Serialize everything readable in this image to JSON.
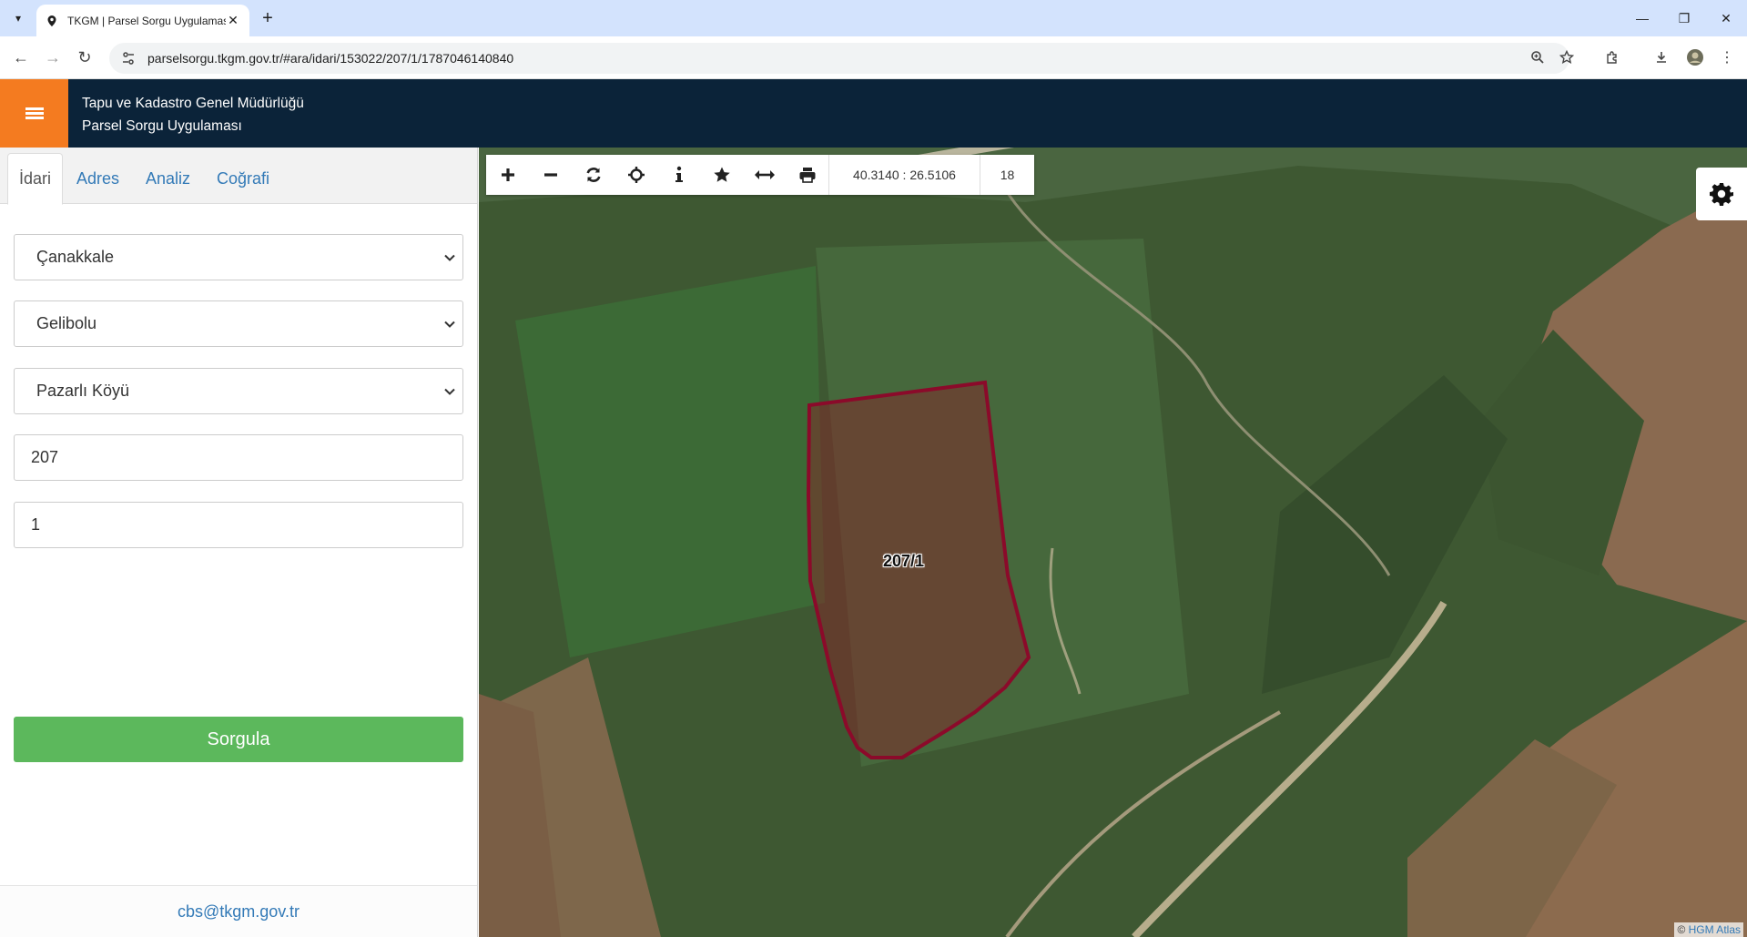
{
  "browser": {
    "tab_title": "TKGM | Parsel Sorgu Uygulaması",
    "url": "parselsorgu.tkgm.gov.tr/#ara/idari/153022/207/1/1787046140840"
  },
  "header": {
    "line1": "Tapu ve Kadastro Genel Müdürlüğü",
    "line2": "Parsel Sorgu Uygulaması"
  },
  "sidebar": {
    "tabs": [
      {
        "label": "İdari",
        "active": true
      },
      {
        "label": "Adres"
      },
      {
        "label": "Analiz"
      },
      {
        "label": "Coğrafi"
      }
    ],
    "province": "Çanakkale",
    "district": "Gelibolu",
    "neighborhood": "Pazarlı Köyü",
    "block": "207",
    "parcel": "1",
    "submit_label": "Sorgula",
    "footer_email": "cbs@tkgm.gov.tr"
  },
  "map": {
    "tools": [
      "plus-icon",
      "minus-icon",
      "refresh-icon",
      "locate-icon",
      "info-icon",
      "star-icon",
      "measure-icon",
      "print-icon"
    ],
    "coordinates": "40.3140 : 26.5106",
    "zoom": "18",
    "parcel_label": "207/1",
    "parcel_color": "#8b0a2a",
    "attribution_prefix": "©",
    "attribution_link": "HGM Atlas"
  },
  "colors": {
    "header_bg": "#0b2339",
    "menu_accent": "#f47b20",
    "submit_bg": "#5cb85c",
    "link": "#337ab7"
  }
}
